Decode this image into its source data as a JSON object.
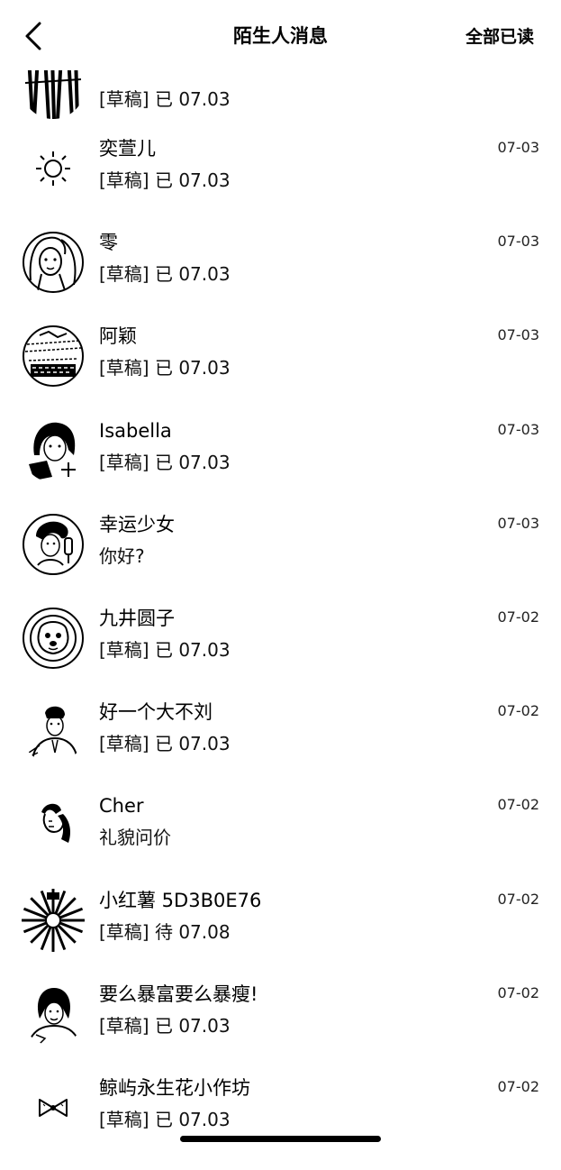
{
  "header": {
    "title": "陌生人消息",
    "mark_all_read": "全部已读",
    "back_icon": "chevron-left-icon"
  },
  "conversations": [
    {
      "name": "",
      "preview": "[草稿] 已 07.03",
      "time": ""
    },
    {
      "name": "奕萱儿",
      "preview": "[草稿] 已 07.03",
      "time": "07-03"
    },
    {
      "name": "零",
      "preview": "[草稿] 已 07.03",
      "time": "07-03"
    },
    {
      "name": "阿颖",
      "preview": "[草稿] 已 07.03",
      "time": "07-03"
    },
    {
      "name": "Isabella",
      "preview": "[草稿] 已 07.03",
      "time": "07-03"
    },
    {
      "name": "幸运少女",
      "preview": "你好?",
      "time": "07-03"
    },
    {
      "name": "九井圆子",
      "preview": "[草稿] 已 07.03",
      "time": "07-02"
    },
    {
      "name": "好一个大不刘",
      "preview": "[草稿] 已 07.03",
      "time": "07-02"
    },
    {
      "name": "Cher",
      "preview": "礼貌问价",
      "time": "07-02"
    },
    {
      "name": "小红薯 5D3B0E76",
      "preview": "[草稿] 待 07.08",
      "time": "07-02"
    },
    {
      "name": "要么暴富要么暴瘦!",
      "preview": "[草稿] 已 07.03",
      "time": "07-02"
    },
    {
      "name": "鲸屿永生花小作坊",
      "preview": "[草稿] 已 07.03",
      "time": "07-02"
    }
  ]
}
